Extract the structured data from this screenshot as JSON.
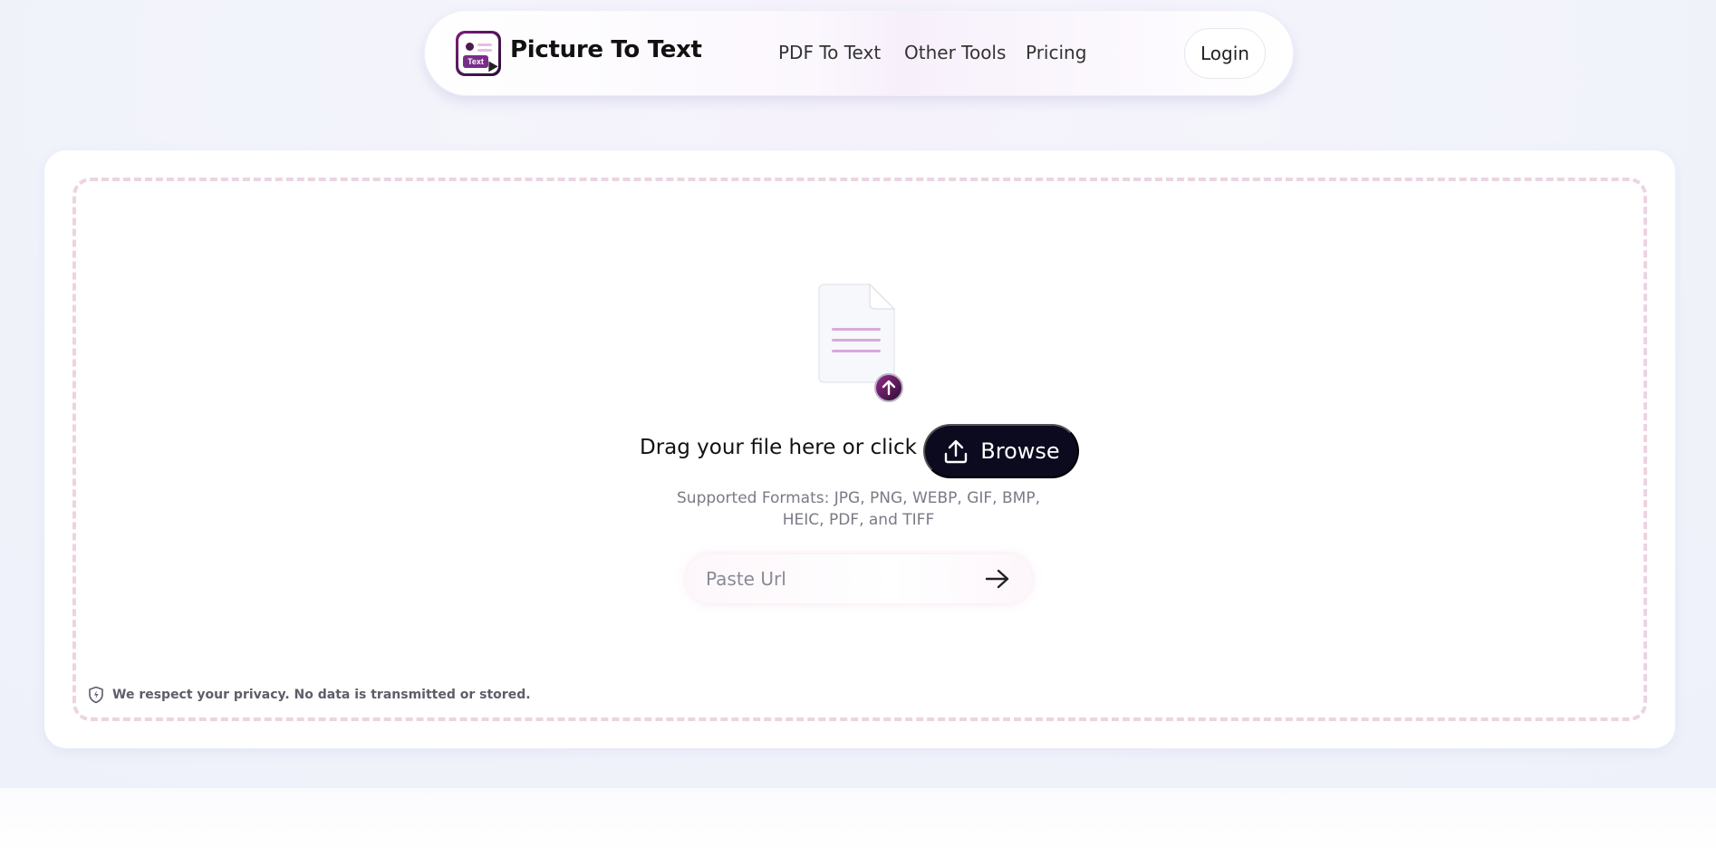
{
  "header": {
    "brand": "Picture To Text",
    "logo_tag": "Text",
    "nav": [
      "PDF To Text",
      "Other Tools",
      "Pricing"
    ],
    "login_label": "Login"
  },
  "upload": {
    "drag_text": "Drag your file here or click",
    "browse_label": "Browse",
    "formats_line1": "Supported Formats: JPG, PNG, WEBP, GIF, BMP,",
    "formats_line2": "HEIC, PDF, and TIFF",
    "url_placeholder": "Paste Url",
    "privacy_text": "We respect your privacy. No data is transmitted or stored."
  },
  "colors": {
    "accent_dark": "#0b0a1e",
    "brand_purple": "#7b1c77",
    "dash_border": "#ecd4e2"
  }
}
